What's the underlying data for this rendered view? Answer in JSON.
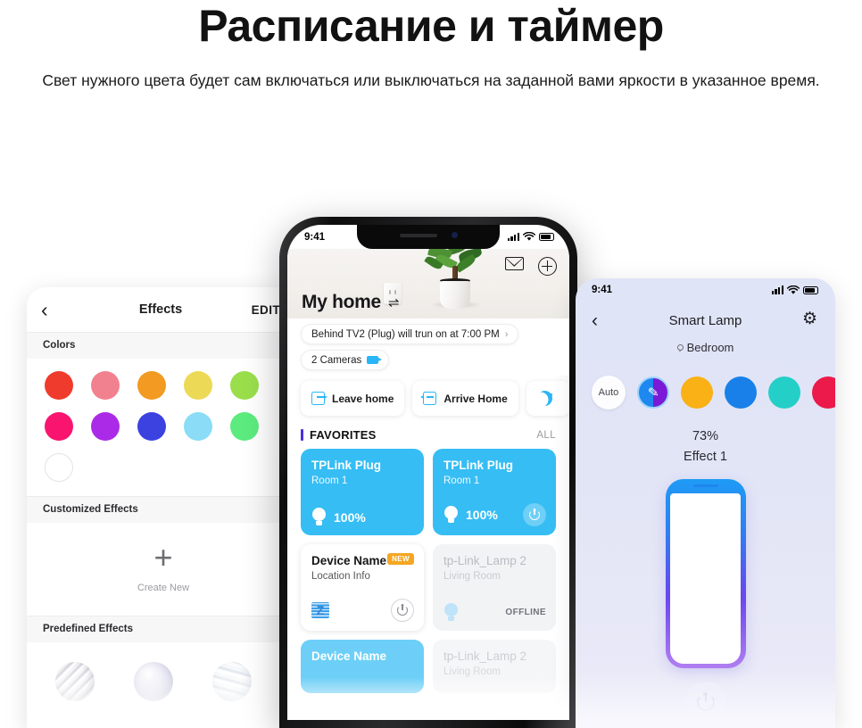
{
  "hero": {
    "title": "Расписание и таймер",
    "subtitle": "Свет нужного цвета будет сам включаться или выключаться на заданной вами яркости в указанное время."
  },
  "left_phone": {
    "nav": {
      "back_icon": "chevron-left-icon",
      "title": "Effects",
      "edit_label": "EDIT"
    },
    "sections": {
      "colors": "Colors",
      "customized": "Customized Effects",
      "predefined": "Predefined Effects"
    },
    "color_rows": [
      [
        "#ef3b2d",
        "#f2818f",
        "#f29a22",
        "#ecd955",
        "#9ade4c"
      ],
      [
        "#f9156f",
        "#ab2ae8",
        "#3b42e0",
        "#8adcf7",
        "#5ceb7f"
      ],
      [
        "#ffffff"
      ]
    ],
    "create": {
      "plus_icon": "plus-icon",
      "label": "Create New"
    },
    "predefined_orbs": [
      "orb-stripes",
      "orb-lavender",
      "orb-frost"
    ]
  },
  "center_phone": {
    "status": {
      "time": "9:41",
      "signal_icon": "signal-bars-icon",
      "wifi_icon": "wifi-icon",
      "battery_icon": "battery-icon"
    },
    "header": {
      "title": "My home",
      "swap_icon": "swap-arrows-icon",
      "mail_icon": "mail-icon",
      "add_icon": "plus-circle-icon"
    },
    "pills": [
      {
        "text": "Behind TV2 (Plug) will trun on at 7:00 PM",
        "chevron": "›"
      },
      {
        "text": "2 Cameras",
        "icon": "camera-icon"
      }
    ],
    "scenes": [
      {
        "label": "Leave home",
        "icon": "leave-home-icon"
      },
      {
        "label": "Arrive Home",
        "icon": "arrive-home-icon"
      },
      {
        "label": "",
        "icon": "moon-icon"
      }
    ],
    "favorites": {
      "label": "FAVORITES",
      "all_label": "ALL"
    },
    "cards": [
      {
        "title": "TPLink Plug",
        "subtitle": "Room 1",
        "value": "100%",
        "state": "on",
        "power": false
      },
      {
        "title": "TPLink Plug",
        "subtitle": "Room 1",
        "value": "100%",
        "state": "on",
        "power": true
      },
      {
        "title": "Device Name",
        "subtitle": "Location Info",
        "badge": "NEW",
        "state": "white",
        "power": true
      },
      {
        "title": "tp-Link_Lamp 2",
        "subtitle": "Living Room",
        "value": "OFFLINE",
        "state": "offline"
      },
      {
        "title": "Device Name",
        "subtitle": "",
        "state": "on"
      },
      {
        "title": "tp-Link_Lamp 2",
        "subtitle": "Living Room",
        "state": "offline"
      }
    ]
  },
  "right_phone": {
    "status": {
      "time": "9:41",
      "signal_icon": "signal-bars-icon",
      "wifi_icon": "wifi-icon",
      "battery_icon": "battery-icon"
    },
    "nav": {
      "back_icon": "chevron-left-icon",
      "title": "Smart Lamp",
      "settings_icon": "gear-icon"
    },
    "room": {
      "pin_icon": "location-pin-icon",
      "label": "Bedroom"
    },
    "color_picker": {
      "auto_label": "Auto",
      "edit_icon": "pencil-icon",
      "swatches": [
        "#f9b115",
        "#1880e8",
        "#24cfc8",
        "#ec1a4b"
      ]
    },
    "brightness": {
      "percent": "73%",
      "effect": "Effect 1"
    },
    "power_icon": "power-icon"
  }
}
